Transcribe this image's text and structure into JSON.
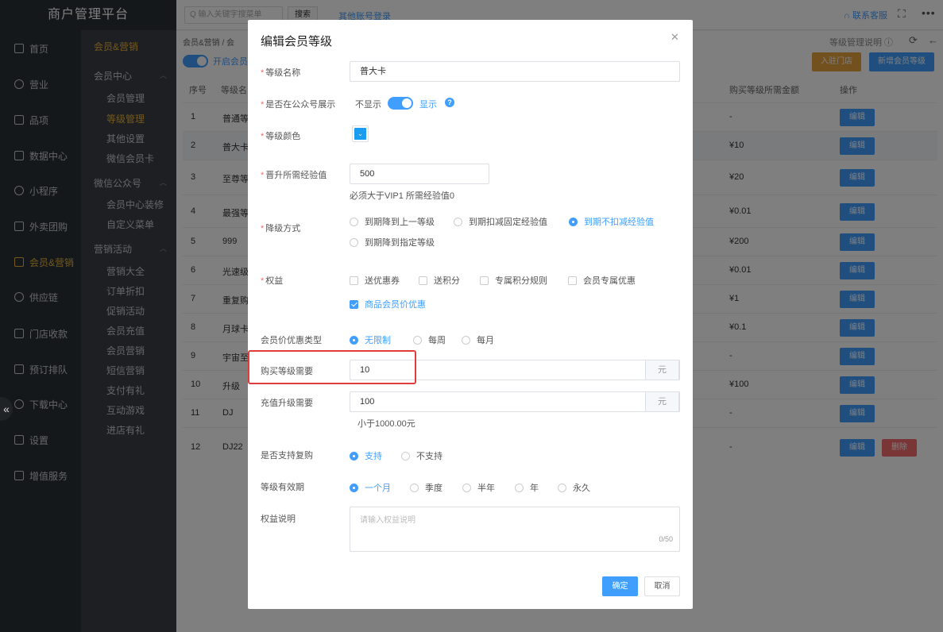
{
  "app_title": "商户管理平台",
  "nav": {
    "items": [
      {
        "label": "首页",
        "icon": "home-icon"
      },
      {
        "label": "营业",
        "icon": "calendar-icon"
      },
      {
        "label": "品项",
        "icon": "bag-icon"
      },
      {
        "label": "数据中心",
        "icon": "share-icon"
      },
      {
        "label": "小程序",
        "icon": "phone-icon"
      },
      {
        "label": "外卖团购",
        "icon": "group-icon"
      },
      {
        "label": "会员&营销",
        "icon": "user-icon"
      },
      {
        "label": "供应链",
        "icon": "truck-icon"
      },
      {
        "label": "门店收款",
        "icon": "coin-icon"
      },
      {
        "label": "预订排队",
        "icon": "clock-icon"
      },
      {
        "label": "下载中心",
        "icon": "download-icon"
      },
      {
        "label": "设置",
        "icon": "gear-icon"
      },
      {
        "label": "增值服务",
        "icon": "service-icon"
      }
    ]
  },
  "subnav": {
    "top": "会员&营销",
    "groups": [
      {
        "title": "会员中心",
        "links": [
          "会员管理",
          "等级管理",
          "其他设置",
          "微信会员卡"
        ]
      },
      {
        "title": "微信公众号",
        "links": [
          "会员中心装修",
          "自定义菜单"
        ]
      },
      {
        "title": "营销活动",
        "links": [
          "营销大全",
          "订单折扣",
          "促销活动",
          "会员充值",
          "会员营销",
          "短信营销",
          "支付有礼",
          "互动游戏",
          "进店有礼"
        ]
      }
    ]
  },
  "topbar": {
    "search_placeholder": "Q 输入关键字搜菜单",
    "search_button": "搜索",
    "other_login": "其他账号登录",
    "service": "∩ 联系客服"
  },
  "content": {
    "breadcrumb": "会员&营销 / 会",
    "switch_label": "开启会员",
    "help_link": "等级管理说明 ⓘ",
    "enter_store_button": "入驻门店",
    "add_level_button": "新增会员等级",
    "table": {
      "headers": [
        "序号",
        "等级名",
        "购买等级所需金额",
        "操作"
      ],
      "rows": [
        {
          "index": "1",
          "name": "普通等",
          "amount": "-",
          "delete": false
        },
        {
          "index": "2",
          "name": "普大卡",
          "amount": "¥10",
          "delete": false
        },
        {
          "index": "3",
          "name": "至尊等",
          "amount": "¥20",
          "delete": false
        },
        {
          "index": "4",
          "name": "最强等",
          "amount": "¥0.01",
          "delete": false
        },
        {
          "index": "5",
          "name": "999",
          "amount": "¥200",
          "delete": false
        },
        {
          "index": "6",
          "name": "光速级",
          "amount": "¥0.01",
          "delete": false
        },
        {
          "index": "7",
          "name": "重复购",
          "amount": "¥1",
          "delete": false
        },
        {
          "index": "8",
          "name": "月球卡",
          "amount": "¥0.1",
          "delete": false
        },
        {
          "index": "9",
          "name": "宇宙至",
          "amount": "-",
          "delete": false
        },
        {
          "index": "10",
          "name": "升级",
          "amount": "¥100",
          "delete": false
        },
        {
          "index": "11",
          "name": "DJ",
          "amount": "-",
          "delete": false
        },
        {
          "index": "12",
          "name": "DJ22",
          "amount": "-",
          "delete": true
        }
      ],
      "edit_label": "编辑",
      "delete_label": "删除"
    }
  },
  "dialog": {
    "title": "编辑会员等级",
    "fields": {
      "level_name": {
        "label": "等级名称",
        "value": "普大卡"
      },
      "show_in_official": {
        "label": "是否在公众号展示",
        "off": "不显示",
        "on": "显示"
      },
      "level_color": {
        "label": "等级颜色",
        "value": "#1a9cf0"
      },
      "upgrade_exp": {
        "label": "晋升所需经验值",
        "value": "500",
        "hint": "必须大于VIP1 所需经验值0"
      },
      "downgrade": {
        "label": "降级方式",
        "options": [
          "到期降到上一等级",
          "到期扣减固定经验值",
          "到期不扣减经验值",
          "到期降到指定等级"
        ],
        "selected": 2
      },
      "benefits": {
        "label": "权益",
        "options": [
          "送优惠券",
          "送积分",
          "专属积分规则",
          "会员专属优惠",
          "商品会员价优惠"
        ],
        "checked": [
          4
        ]
      },
      "discount_type": {
        "label": "会员价优惠类型",
        "options": [
          "无限制",
          "每周",
          "每月"
        ],
        "selected": 0
      },
      "purchase_amount": {
        "label": "购买等级需要",
        "value": "10",
        "unit": "元"
      },
      "recharge_amount": {
        "label": "充值升级需要",
        "value": "100",
        "unit": "元",
        "hint": "小于1000.00元"
      },
      "repurchase": {
        "label": "是否支持复购",
        "options": [
          "支持",
          "不支持"
        ],
        "selected": 0
      },
      "validity": {
        "label": "等级有效期",
        "options": [
          "一个月",
          "季度",
          "半年",
          "年",
          "永久"
        ],
        "selected": 0
      },
      "description": {
        "label": "权益说明",
        "placeholder": "请输入权益说明",
        "count": "0/50"
      }
    },
    "confirm": "确定",
    "cancel": "取消"
  },
  "colors": {
    "primary": "#409eff",
    "accent": "#e8b23a",
    "danger": "#f56c6c",
    "highlight": "#e03c3c"
  }
}
